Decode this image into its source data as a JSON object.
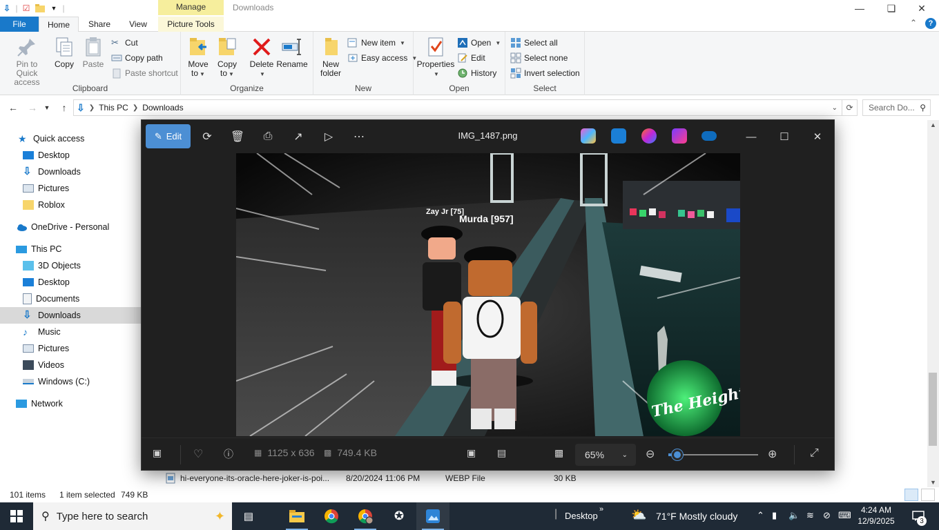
{
  "titlebar": {
    "title": "Downloads",
    "manage_tab": "Manage"
  },
  "ribbon_tabs": [
    "File",
    "Home",
    "Share",
    "View",
    "Picture Tools"
  ],
  "ribbon": {
    "clipboard": {
      "label": "Clipboard",
      "pin": [
        "Pin to Quick",
        "access"
      ],
      "copy": "Copy",
      "paste": "Paste",
      "cut": "Cut",
      "copy_path": "Copy path",
      "paste_shortcut": "Paste shortcut"
    },
    "organize": {
      "label": "Organize",
      "move_to": [
        "Move",
        "to"
      ],
      "copy_to": [
        "Copy",
        "to"
      ],
      "delete": "Delete",
      "rename": "Rename"
    },
    "new": {
      "label": "New",
      "new_folder": [
        "New",
        "folder"
      ],
      "new_item": "New item",
      "easy_access": "Easy access"
    },
    "open": {
      "label": "Open",
      "properties": "Properties",
      "open": "Open",
      "edit": "Edit",
      "history": "History"
    },
    "select": {
      "label": "Select",
      "select_all": "Select all",
      "select_none": "Select none",
      "invert": "Invert selection"
    }
  },
  "address": {
    "crumbs": [
      "This PC",
      "Downloads"
    ],
    "search_placeholder": "Search Do..."
  },
  "nav": {
    "quick_access": "Quick access",
    "qa_items": [
      "Desktop",
      "Downloads",
      "Pictures",
      "Roblox"
    ],
    "onedrive": "OneDrive - Personal",
    "this_pc": "This PC",
    "pc_items": [
      "3D Objects",
      "Desktop",
      "Documents",
      "Downloads",
      "Music",
      "Pictures",
      "Videos",
      "Windows (C:)"
    ],
    "network": "Network"
  },
  "file_row": {
    "name": "hi-everyone-its-oracle-here-joker-is-poi...",
    "date": "8/20/2024 11:06 PM",
    "type": "WEBP File",
    "size": "30 KB"
  },
  "status": {
    "items": "101 items",
    "selected": "1 item selected",
    "size": "749 KB"
  },
  "photos": {
    "edit_label": "Edit",
    "filename": "IMG_1487.png",
    "dimensions": "1125 x 636",
    "filesize": "749.4 KB",
    "zoom": "65%",
    "zoom_fraction": 0.1,
    "image_text": {
      "tag1": "Zay Jr [75]",
      "tag2": "Murda [957]",
      "logo": "The Heights"
    }
  },
  "taskbar": {
    "search_placeholder": "Type here to search",
    "desktop_label": "Desktop",
    "weather": "71°F  Mostly cloudy",
    "time": "4:24 AM",
    "date": "12/9/2025",
    "notifications": "3"
  }
}
